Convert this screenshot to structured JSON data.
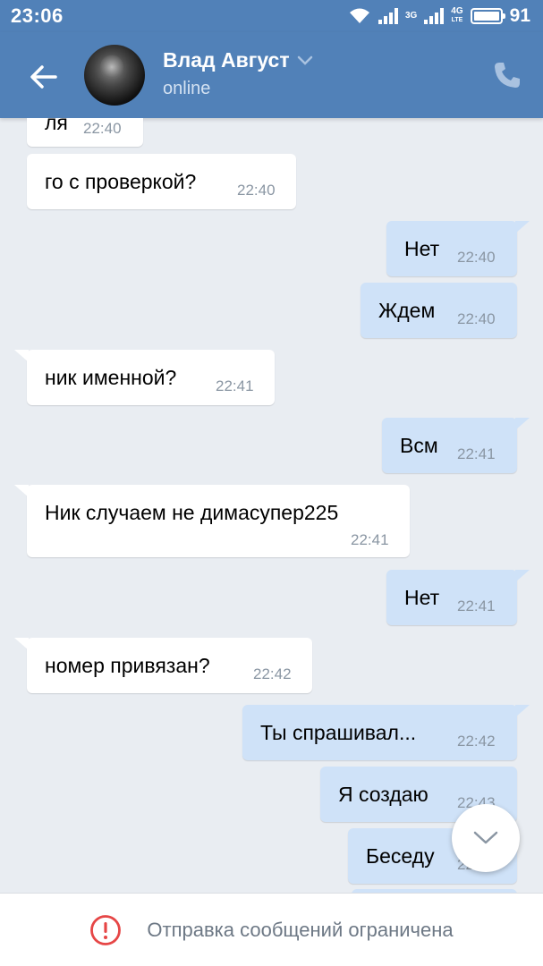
{
  "statusbar": {
    "time": "23:06",
    "net1": "3G",
    "net2": "4G",
    "net2_sub": "LTE",
    "battery": "91"
  },
  "header": {
    "name": "Влад Август",
    "status": "online"
  },
  "messages": [
    {
      "dir": "in",
      "text": "ля",
      "time": "22:40"
    },
    {
      "dir": "in",
      "text": "го с проверкой?",
      "time": "22:40"
    },
    {
      "dir": "out",
      "text": "Нет",
      "time": "22:40"
    },
    {
      "dir": "out",
      "text": "Ждем",
      "time": "22:40"
    },
    {
      "dir": "in",
      "text": "ник именной?",
      "time": "22:41"
    },
    {
      "dir": "out",
      "text": "Всм",
      "time": "22:41"
    },
    {
      "dir": "in",
      "text": "Ник случаем не димасупер225",
      "time": "22:41"
    },
    {
      "dir": "out",
      "text": "Нет",
      "time": "22:41"
    },
    {
      "dir": "in",
      "text": "номер привязан?",
      "time": "22:42"
    },
    {
      "dir": "out",
      "text": "Ты спрашивал...",
      "time": "22:42"
    },
    {
      "dir": "out",
      "text": "Я создаю",
      "time": "22:43"
    },
    {
      "dir": "out",
      "text": "Беседу",
      "time": "22:43"
    }
  ],
  "footer": {
    "notice": "Отправка сообщений ограничена"
  },
  "colors": {
    "header": "#5181b8",
    "bubble_in": "#ffffff",
    "bubble_out": "#cfe2f8",
    "background": "#e9edf2",
    "warning": "#e64646"
  }
}
